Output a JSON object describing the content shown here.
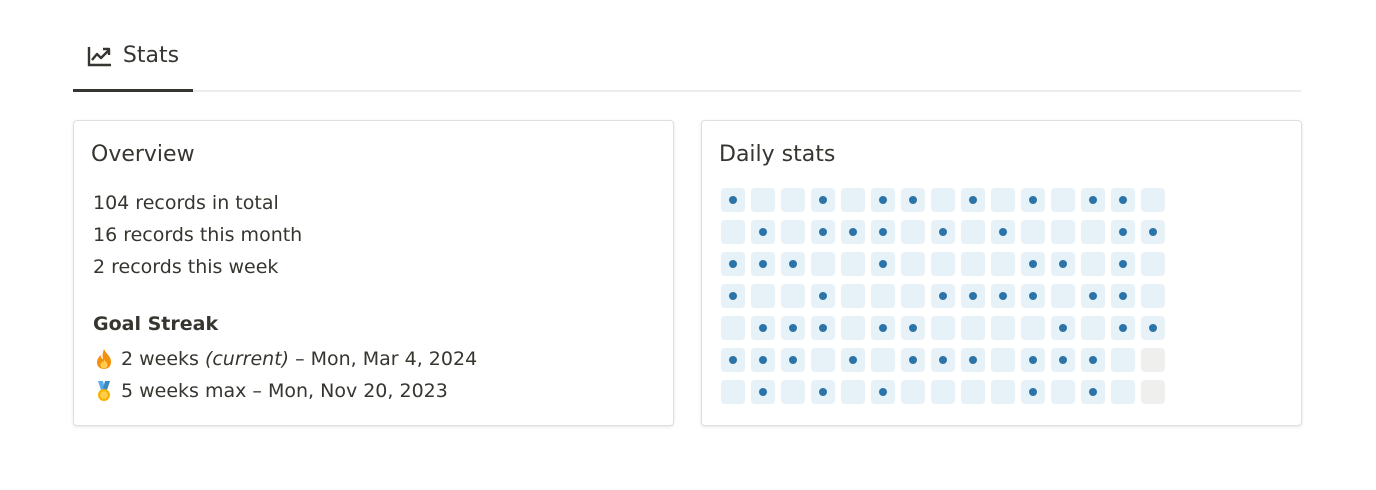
{
  "tab": {
    "label": "Stats",
    "icon": "trending-up-icon"
  },
  "overview": {
    "title": "Overview",
    "total": "104 records in total",
    "month": "16 records this month",
    "week": "2 records this week",
    "streak_title": "Goal Streak",
    "current_icon": "fire-icon",
    "current_weeks": "2 weeks",
    "current_tag": "(current)",
    "current_date": "– Mon, Mar 4, 2024",
    "max_icon": "medal-icon",
    "max_text": "5 weeks max – Mon, Nov 20, 2023"
  },
  "daily": {
    "title": "Daily stats",
    "colors": {
      "cell": "#e6f1f8",
      "dot": "#2c74a8",
      "future": "#efefee"
    },
    "rows": [
      [
        1,
        0,
        0,
        1,
        0,
        1,
        1,
        0,
        1,
        0,
        1,
        0,
        1,
        1,
        0
      ],
      [
        0,
        1,
        0,
        1,
        1,
        1,
        0,
        1,
        0,
        1,
        0,
        0,
        0,
        1,
        1
      ],
      [
        1,
        1,
        1,
        0,
        0,
        1,
        0,
        0,
        0,
        0,
        1,
        1,
        0,
        1,
        0
      ],
      [
        1,
        0,
        0,
        1,
        0,
        0,
        0,
        1,
        1,
        1,
        1,
        0,
        1,
        1,
        0
      ],
      [
        0,
        1,
        1,
        1,
        0,
        1,
        1,
        0,
        0,
        0,
        0,
        1,
        0,
        1,
        1
      ],
      [
        1,
        1,
        1,
        0,
        1,
        0,
        1,
        1,
        1,
        0,
        1,
        1,
        1,
        0,
        -1
      ],
      [
        0,
        1,
        0,
        1,
        0,
        1,
        0,
        0,
        0,
        0,
        1,
        0,
        1,
        0,
        -1
      ]
    ]
  }
}
